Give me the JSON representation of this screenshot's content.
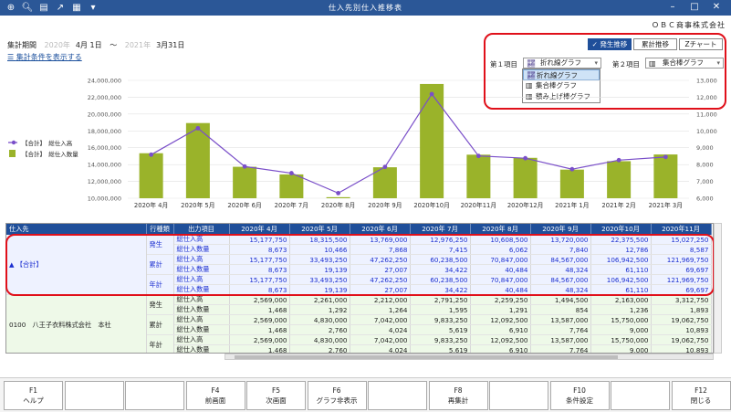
{
  "app": {
    "title": "仕入先別仕入推移表",
    "company": "ＯＢＣ商事株式会社"
  },
  "toolbar_icons": [
    "add-icon",
    "zoom-icon",
    "print-icon",
    "export-icon",
    "excel-icon",
    "menu-icon"
  ],
  "period": {
    "label": "集計期間",
    "from_year": "2020年",
    "from_md": "4月 1日",
    "sep": "〜",
    "to_year": "2021年",
    "to_md": "3月31日"
  },
  "cond_link": "集計条件を表示する",
  "chart_buttons": [
    {
      "label": "発生推移",
      "active": true
    },
    {
      "label": "累計推移",
      "active": false
    },
    {
      "label": "Ζチャート",
      "active": false
    }
  ],
  "item1": {
    "label": "第１項目",
    "value": "折れ線グラフ"
  },
  "item2": {
    "label": "第２項目",
    "value": "集合棒グラフ"
  },
  "dropdown": [
    "折れ線グラフ",
    "集合棒グラフ",
    "積み上げ棒グラフ"
  ],
  "legend": [
    {
      "label": "【合計】　総仕入高",
      "color": "#7a4fc9"
    },
    {
      "label": "【合計】　総仕入数量",
      "color": "#9ab32a"
    }
  ],
  "chart_data": {
    "type": "bar",
    "categories": [
      "2020年 4月",
      "2020年 5月",
      "2020年 6月",
      "2020年 7月",
      "2020年 8月",
      "2020年 9月",
      "2020年10月",
      "2020年11月",
      "2020年12月",
      "2021年 1月",
      "2021年 2月",
      "2021年 3月"
    ],
    "series": [
      {
        "name": "【合計】　総仕入高",
        "type": "line",
        "axis": "left",
        "values": [
          15177750,
          18315500,
          13769000,
          12976250,
          10608500,
          13720000,
          22375500,
          15027250,
          14756000,
          13451000,
          14523000,
          14900000
        ]
      },
      {
        "name": "【合計】　総仕入数量",
        "type": "bar",
        "axis": "right",
        "values": [
          8673,
          10466,
          7868,
          7415,
          6062,
          7840,
          12786,
          8587,
          8400,
          7700,
          8200,
          8600
        ]
      }
    ],
    "y_left": {
      "min": 10000000,
      "max": 24000000,
      "ticks": [
        "10,000,000",
        "12,000,000",
        "14,000,000",
        "16,000,000",
        "18,000,000",
        "20,000,000",
        "22,000,000",
        "24,000,000"
      ]
    },
    "y_right": {
      "min": 6000,
      "max": 13000,
      "ticks": [
        "6,000",
        "7,000",
        "8,000",
        "9,000",
        "10,000",
        "11,000",
        "12,000",
        "13,000"
      ]
    },
    "colors": {
      "bar": "#9ab32a",
      "line": "#7a4fc9"
    }
  },
  "grid": {
    "headers": [
      "仕入先",
      "行種類",
      "出力項目",
      "2020年 4月",
      "2020年 5月",
      "2020年 6月",
      "2020年 7月",
      "2020年 8月",
      "2020年 9月",
      "2020年10月",
      "2020年11月"
    ],
    "sections": [
      {
        "supplier": "▲ 【合計】",
        "style": "g1",
        "groups": [
          {
            "kind": "発生",
            "rows": [
              [
                "総仕入高",
                "15,177,750",
                "18,315,500",
                "13,769,000",
                "12,976,250",
                "10,608,500",
                "13,720,000",
                "22,375,500",
                "15,027,250"
              ],
              [
                "総仕入数量",
                "8,673",
                "10,466",
                "7,868",
                "7,415",
                "6,062",
                "7,840",
                "12,786",
                "8,587"
              ]
            ]
          },
          {
            "kind": "累計",
            "rows": [
              [
                "総仕入高",
                "15,177,750",
                "33,493,250",
                "47,262,250",
                "60,238,500",
                "70,847,000",
                "84,567,000",
                "106,942,500",
                "121,969,750"
              ],
              [
                "総仕入数量",
                "8,673",
                "19,139",
                "27,007",
                "34,422",
                "40,484",
                "48,324",
                "61,110",
                "69,697"
              ]
            ]
          },
          {
            "kind": "年計",
            "rows": [
              [
                "総仕入高",
                "15,177,750",
                "33,493,250",
                "47,262,250",
                "60,238,500",
                "70,847,000",
                "84,567,000",
                "106,942,500",
                "121,969,750"
              ],
              [
                "総仕入数量",
                "8,673",
                "19,139",
                "27,007",
                "34,422",
                "40,484",
                "48,324",
                "61,110",
                "69,697"
              ]
            ]
          }
        ]
      },
      {
        "supplier": "0100　八王子衣料株式会社　本社",
        "style": "g2",
        "groups": [
          {
            "kind": "発生",
            "rows": [
              [
                "総仕入高",
                "2,569,000",
                "2,261,000",
                "2,212,000",
                "2,791,250",
                "2,259,250",
                "1,494,500",
                "2,163,000",
                "3,312,750"
              ],
              [
                "総仕入数量",
                "1,468",
                "1,292",
                "1,264",
                "1,595",
                "1,291",
                "854",
                "1,236",
                "1,893"
              ]
            ]
          },
          {
            "kind": "累計",
            "rows": [
              [
                "総仕入高",
                "2,569,000",
                "4,830,000",
                "7,042,000",
                "9,833,250",
                "12,092,500",
                "13,587,000",
                "15,750,000",
                "19,062,750"
              ],
              [
                "総仕入数量",
                "1,468",
                "2,760",
                "4,024",
                "5,619",
                "6,910",
                "7,764",
                "9,000",
                "10,893"
              ]
            ]
          },
          {
            "kind": "年計",
            "rows": [
              [
                "総仕入高",
                "2,569,000",
                "4,830,000",
                "7,042,000",
                "9,833,250",
                "12,092,500",
                "13,587,000",
                "15,750,000",
                "19,062,750"
              ],
              [
                "総仕入数量",
                "1,468",
                "2,760",
                "4,024",
                "5,619",
                "6,910",
                "7,764",
                "9,000",
                "10,893"
              ]
            ]
          }
        ]
      }
    ]
  },
  "fkeys": [
    {
      "key": "F1",
      "label": "ヘルプ"
    },
    {
      "key": "",
      "label": ""
    },
    {
      "key": "",
      "label": ""
    },
    {
      "key": "F4",
      "label": "前画面"
    },
    {
      "key": "F5",
      "label": "次画面"
    },
    {
      "key": "F6",
      "label": "グラフ非表示"
    },
    {
      "key": "",
      "label": ""
    },
    {
      "key": "F8",
      "label": "再集計"
    },
    {
      "key": "",
      "label": ""
    },
    {
      "key": "F10",
      "label": "条件設定"
    },
    {
      "key": "",
      "label": ""
    },
    {
      "key": "F12",
      "label": "閉じる"
    }
  ]
}
